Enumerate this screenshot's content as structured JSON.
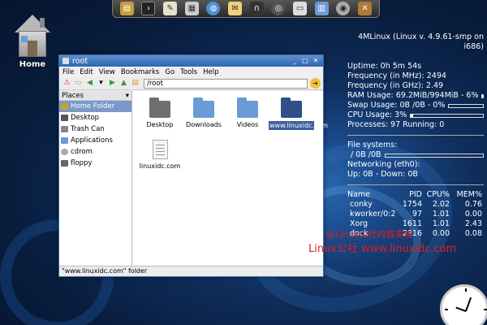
{
  "dock": {
    "icons": [
      "archive-icon",
      "terminal-icon",
      "text-editor-icon",
      "calculator-icon",
      "browser-icon",
      "mail-icon",
      "headphones-icon",
      "film-icon",
      "printer-icon",
      "file-manager-icon",
      "audio-icon",
      "settings-icon"
    ]
  },
  "desktop": {
    "home_label": "Home"
  },
  "conky": {
    "title": "4MLinux (Linux v. 4.9.61-smp on i686)",
    "uptime": "Uptime: 0h 5m 54s",
    "freq_mhz": "Frequency (in MHz): 2494",
    "freq_ghz": "Frequency (in GHz): 2.49",
    "ram": "RAM Usage: 69.2MiB/994MiB - 6%",
    "ram_fraction": 0.06,
    "swap": "Swap Usage: 0B /0B  - 0%",
    "swap_fraction": 0.0,
    "cpu": "CPU Usage: 3%",
    "cpu_fraction": 0.03,
    "processes": "Processes: 97  Running: 0",
    "fs_label": "File systems:",
    "fs_value": "/ 0B /0B",
    "fs_fraction": 0.0,
    "net_label": "Networking (eth0):",
    "net_value": "Up: 0B   - Down: 0B",
    "proc_headers": [
      "Name",
      "PID",
      "CPU%",
      "MEM%"
    ],
    "proc_rows": [
      [
        "conky",
        "1754",
        "2.02",
        "0.76"
      ],
      [
        "kworker/0:2",
        "97",
        "1.01",
        "0.00"
      ],
      [
        "Xorg",
        "1611",
        "1.01",
        "2.43"
      ],
      [
        "dock",
        "2316",
        "0.00",
        "0.08"
      ]
    ]
  },
  "window": {
    "title": "root",
    "menu": [
      "File",
      "Edit",
      "View",
      "Bookmarks",
      "Go",
      "Tools",
      "Help"
    ],
    "address": "/root",
    "sidebar_title": "Places",
    "places": [
      "Home Folder",
      "Desktop",
      "Trash Can",
      "Applications",
      "cdrom",
      "floppy"
    ],
    "files": [
      "Desktop",
      "Downloads",
      "Videos",
      "www.linuxidc.com",
      "linuxidc.com"
    ],
    "status": "\"www.linuxidc.com\" folder"
  },
  "watermark": {
    "line1": "@Linux公社内容来自",
    "line2": "Linux公社 www.linuxidc.com"
  },
  "colors": {
    "titlebar": "#2f65ad",
    "selection": "#3b5fa1",
    "watermark": "#e02020"
  }
}
